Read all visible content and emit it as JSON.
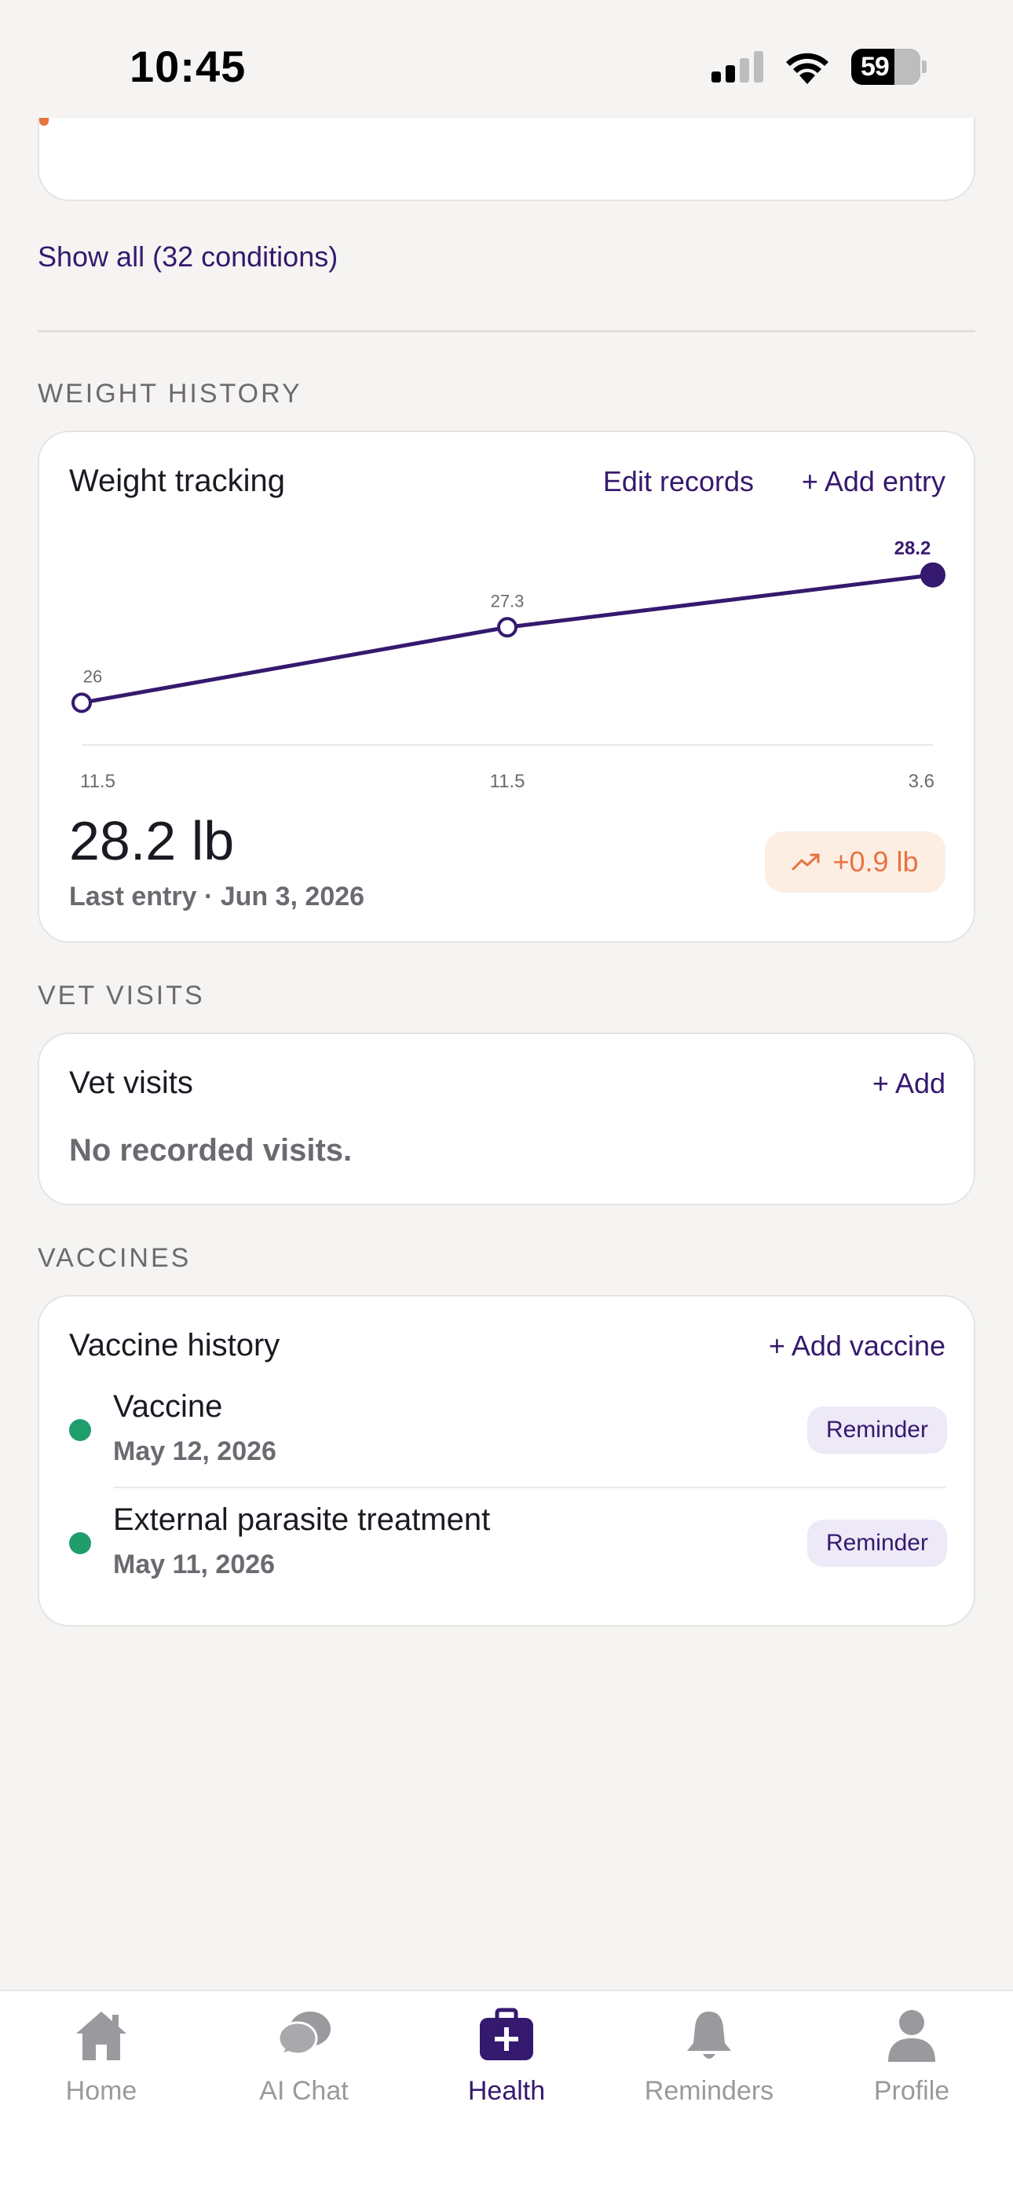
{
  "status_bar": {
    "time": "10:45",
    "battery": "59"
  },
  "conditions": {
    "show_all_label": "Show all (32 conditions)"
  },
  "weight": {
    "section_label": "WEIGHT HISTORY",
    "card_title": "Weight tracking",
    "edit_label": "Edit records",
    "add_label": "+ Add entry",
    "current": "28.2 lb",
    "last_entry": "Last entry · Jun 3, 2026",
    "delta": "+0.9 lb"
  },
  "chart_data": {
    "type": "line",
    "x": [
      "11.5",
      "11.5",
      "3.6"
    ],
    "series": [
      {
        "values": [
          26,
          27.3,
          28.2
        ]
      }
    ],
    "point_labels": [
      "26",
      "27.3",
      "28.2"
    ],
    "ylim": [
      24.3,
      28.9
    ],
    "grid": false,
    "accent": "#35196e"
  },
  "vet": {
    "section_label": "VET VISITS",
    "card_title": "Vet visits",
    "add_label": "+ Add",
    "empty": "No recorded visits."
  },
  "vaccines": {
    "section_label": "VACCINES",
    "card_title": "Vaccine history",
    "add_label": "+ Add vaccine",
    "items": [
      {
        "name": "Vaccine",
        "date": "May 12, 2026",
        "badge": "Reminder"
      },
      {
        "name": "External parasite treatment",
        "date": "May 11, 2026",
        "badge": "Reminder"
      }
    ]
  },
  "tabs": [
    {
      "label": "Home",
      "icon": "home-icon"
    },
    {
      "label": "AI Chat",
      "icon": "chat-icon"
    },
    {
      "label": "Health",
      "icon": "health-kit-icon",
      "active": true
    },
    {
      "label": "Reminders",
      "icon": "bell-icon"
    },
    {
      "label": "Profile",
      "icon": "person-icon"
    }
  ],
  "colors": {
    "accent": "#35196e",
    "orange": "#e8733f",
    "green": "#1f9d6b",
    "bg": "#f5f4f2"
  }
}
